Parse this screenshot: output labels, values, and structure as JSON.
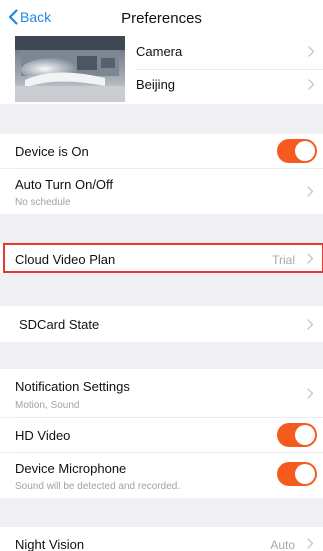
{
  "nav": {
    "back_label": "Back",
    "title": "Preferences"
  },
  "camera": {
    "name": "Camera",
    "location": "Beijing"
  },
  "colors": {
    "accent": "#1e88e5",
    "toggle_on": "#f55a1f",
    "highlight": "#e53935"
  },
  "settings": {
    "device_on": {
      "label": "Device is On",
      "enabled": true
    },
    "auto_turn": {
      "label": "Auto Turn On/Off",
      "sub": "No schedule"
    },
    "cloud_video": {
      "label": "Cloud Video Plan",
      "value": "Trial"
    },
    "sdcard": {
      "label": "SDCard State"
    },
    "notifications": {
      "label": "Notification Settings",
      "sub": "Motion, Sound"
    },
    "hd_video": {
      "label": "HD Video",
      "enabled": true
    },
    "microphone": {
      "label": "Device Microphone",
      "sub": "Sound will be detected and recorded.",
      "enabled": true
    },
    "night_vision": {
      "label": "Night Vision",
      "value": "Auto"
    }
  }
}
